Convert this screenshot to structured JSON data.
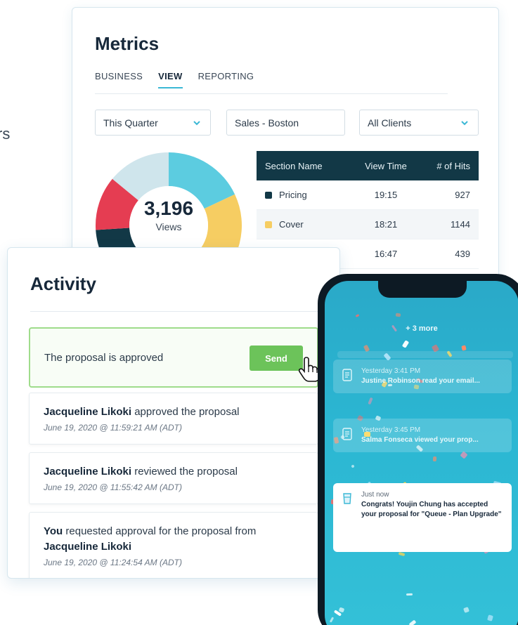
{
  "edge_text": "rs",
  "metrics": {
    "title": "Metrics",
    "tabs": [
      {
        "label": "BUSINESS",
        "active": false
      },
      {
        "label": "VIEW",
        "active": true
      },
      {
        "label": "REPORTING",
        "active": false
      }
    ],
    "filters": [
      {
        "label": "This Quarter",
        "has_chevron": true
      },
      {
        "label": "Sales - Boston",
        "has_chevron": false
      },
      {
        "label": "All Clients",
        "has_chevron": true
      }
    ],
    "donut": {
      "value": "3,196",
      "label": "Views",
      "segments": [
        {
          "color": "#5ccce0",
          "fraction": 0.18
        },
        {
          "color": "#f6cd62",
          "fraction": 0.22
        },
        {
          "color": "#f0c35a",
          "fraction": 0.1
        },
        {
          "color": "#123846",
          "fraction": 0.24
        },
        {
          "color": "#e53d52",
          "fraction": 0.12
        },
        {
          "color": "#cfe5ec",
          "fraction": 0.14
        }
      ]
    },
    "table": {
      "headers": [
        "Section Name",
        "View Time",
        "# of Hits"
      ],
      "rows": [
        {
          "name": "Pricing",
          "time": "19:15",
          "hits": "927",
          "color": "#123846"
        },
        {
          "name": "Cover",
          "time": "18:21",
          "hits": "1144",
          "color": "#f6cd62"
        },
        {
          "name": "",
          "time": "16:47",
          "hits": "439",
          "color": ""
        }
      ]
    }
  },
  "activity": {
    "title": "Activity",
    "approval": {
      "text": "The proposal is approved",
      "button": "Send"
    },
    "items": [
      {
        "who": "Jacqueline Likoki",
        "action": " approved the proposal",
        "extra": "",
        "date": "June 19, 2020 @ 11:59:21 AM (ADT)"
      },
      {
        "who": "Jacqueline Likoki",
        "action": " reviewed the proposal",
        "extra": "",
        "date": "June 19, 2020 @ 11:55:42 AM (ADT)"
      },
      {
        "who": "You",
        "action": " requested approval for the proposal from",
        "extra": "Jacqueline Likoki",
        "date": "June 19, 2020 @ 11:24:54 AM (ADT)"
      }
    ]
  },
  "phone": {
    "more": "+ 3 more",
    "notifications": [
      {
        "when": "Yesterday 3:41 PM",
        "msg": "Justine Robinson read your email...",
        "style": "faded"
      },
      {
        "when": "Yesterday 3:45 PM",
        "msg": "Salma Fonseca viewed your prop...",
        "style": "faded"
      },
      {
        "when": "Just now",
        "msg": "Congrats! Youjin Chung has accepted your proposal for \"Queue - Plan Upgrade\"",
        "style": "solid"
      }
    ]
  },
  "colors": {
    "accent": "#3bb8d5",
    "dark": "#123846",
    "success": "#6cc35a",
    "phone_bg": "#2bb6d2"
  }
}
